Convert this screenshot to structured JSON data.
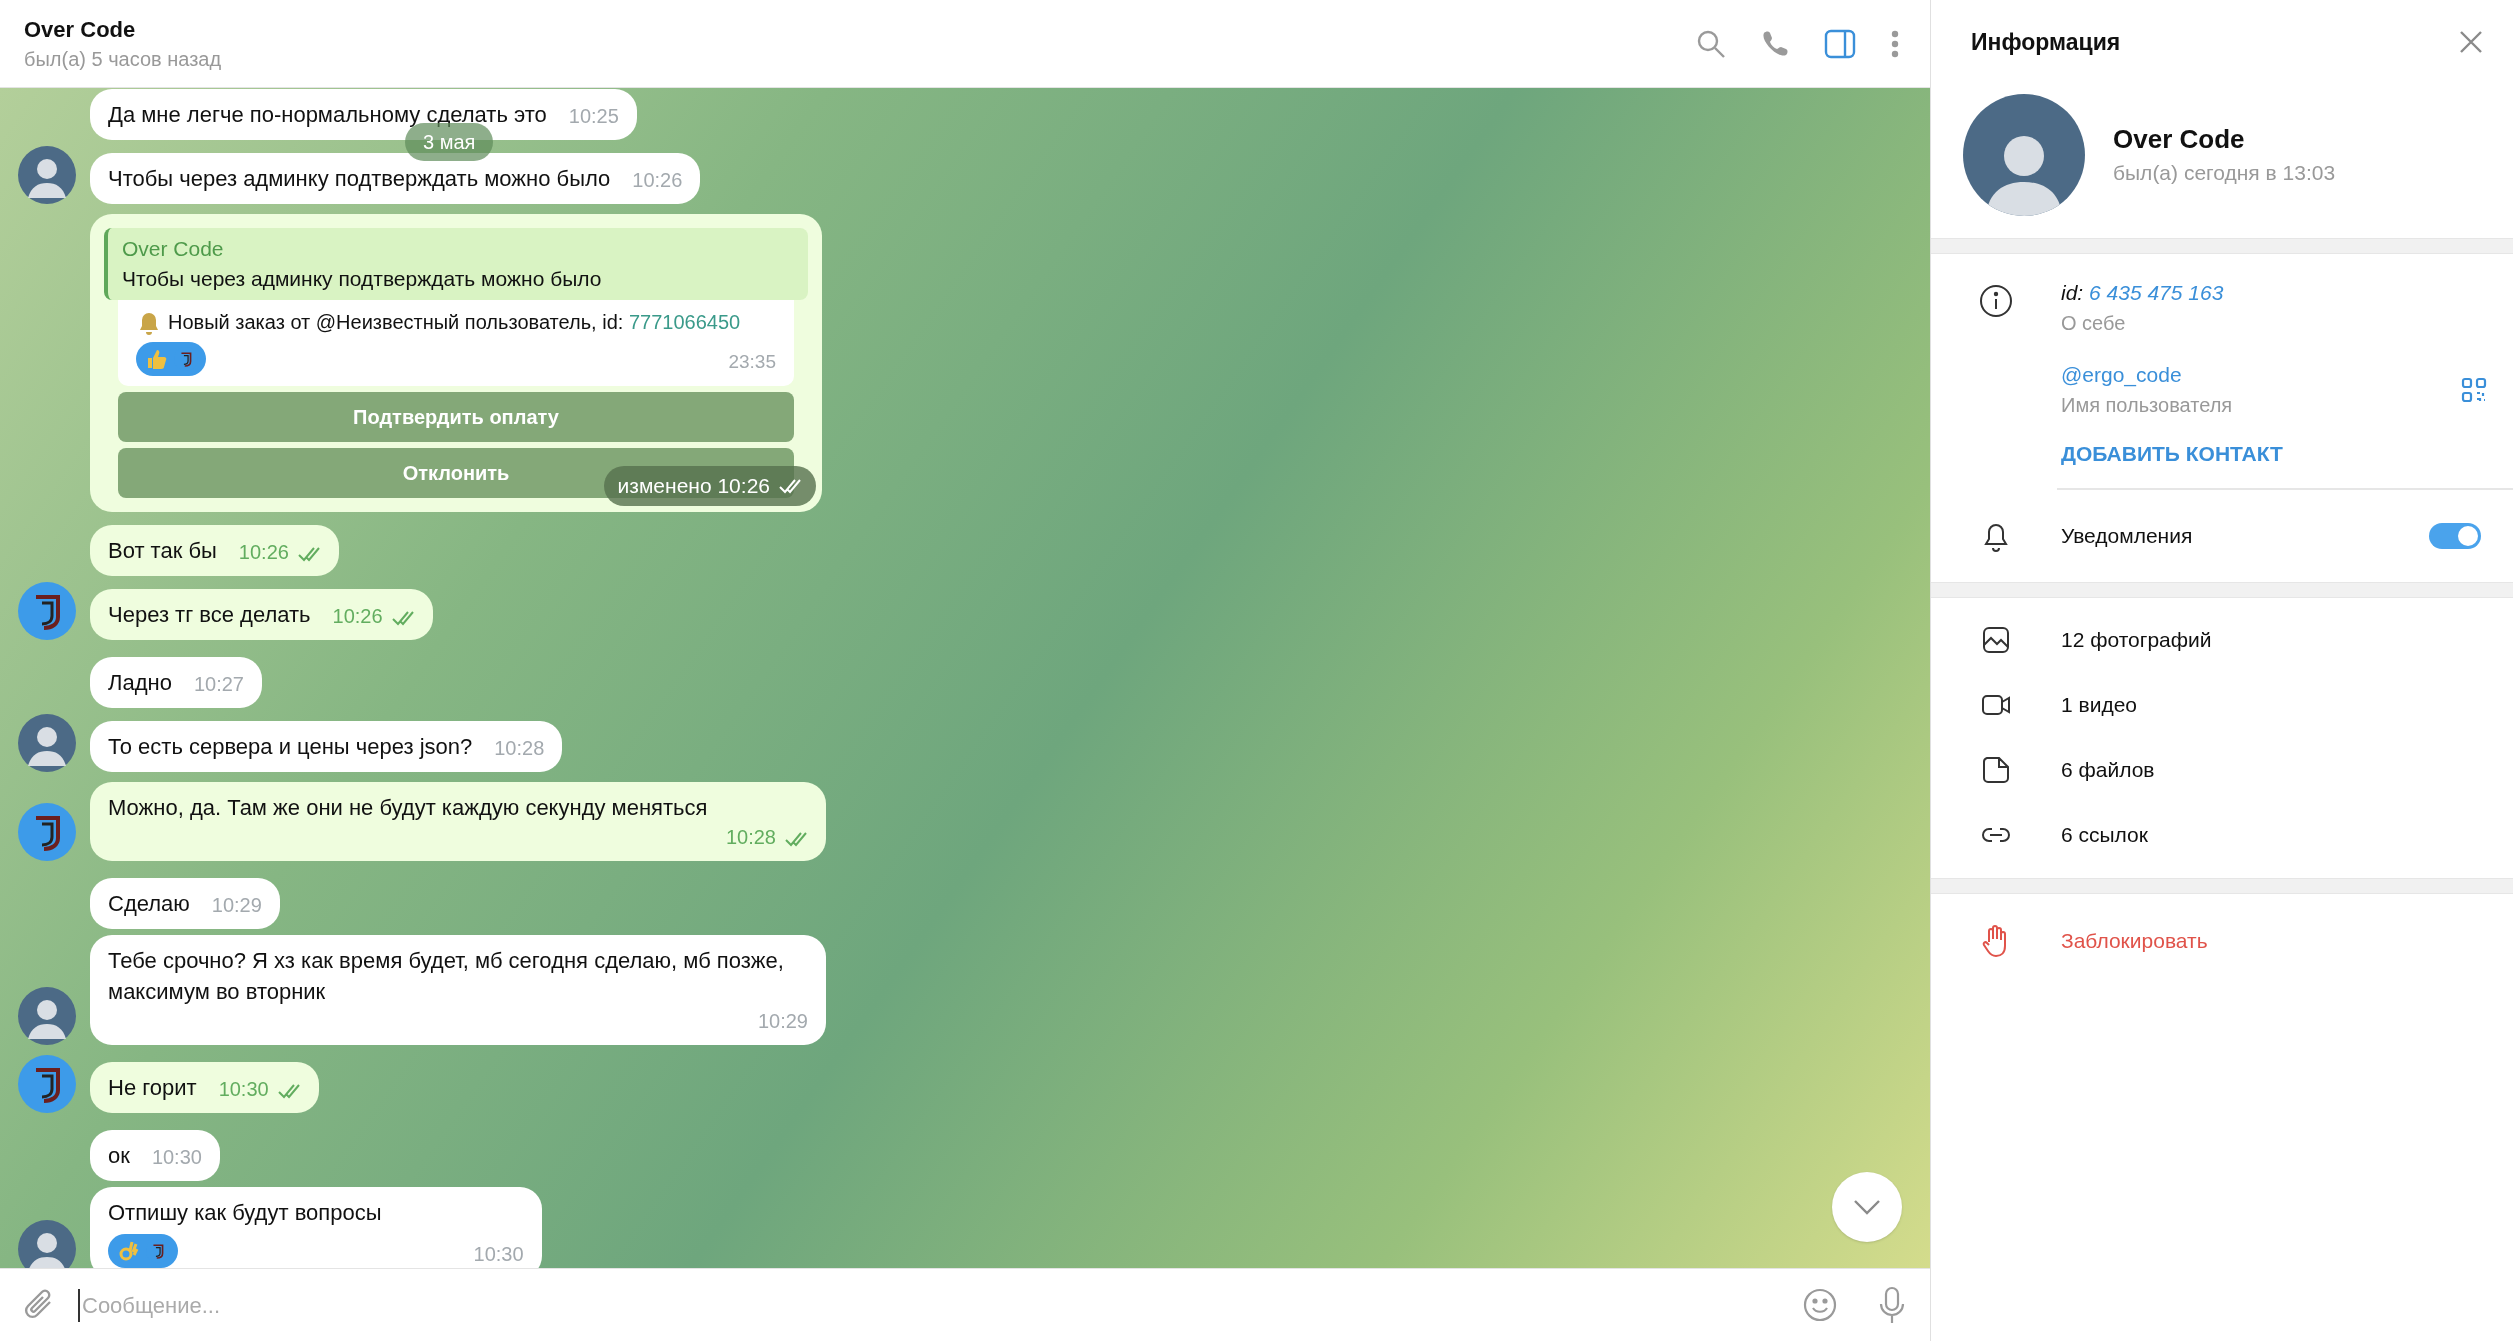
{
  "header": {
    "title": "Over Code",
    "status": "был(а) 5 часов назад",
    "info_panel_open": true
  },
  "messages": [
    {
      "outgoing": false,
      "kind": "text",
      "text": "Да мне легче по-нормальному сделать это",
      "time": "10:25",
      "avatar": false
    },
    {
      "outgoing": false,
      "kind": "text",
      "text": "Чтобы через админку подтверждать можно было",
      "time": "10:26",
      "avatar": true,
      "date_badge": "3 мая"
    },
    {
      "outgoing": true,
      "kind": "reply",
      "reply": {
        "author": "Over Code",
        "text": "Чтобы через админку подтверждать можно было"
      },
      "card": {
        "text": "Новый заказ от @Неизвестный пользователь, id:",
        "link": "7771066450",
        "reaction": {
          "kind": "thumbs"
        },
        "time": "23:35"
      },
      "buttons": [
        "Подтвердить оплату",
        "Отклонить"
      ],
      "time": "изменено 10:26",
      "read": true,
      "avatar": false
    },
    {
      "outgoing": true,
      "kind": "text",
      "text": "Вот так бы",
      "time": "10:26",
      "read": true,
      "avatar": false
    },
    {
      "outgoing": true,
      "kind": "text",
      "text": "Через тг все делать",
      "time": "10:26",
      "read": true,
      "avatar": true
    },
    {
      "outgoing": false,
      "kind": "text",
      "text": "Ладно",
      "time": "10:27",
      "avatar": false
    },
    {
      "outgoing": false,
      "kind": "text",
      "text": "То есть сервера и цены через json?",
      "time": "10:28",
      "avatar": true
    },
    {
      "outgoing": true,
      "kind": "text",
      "text": "Можно, да. Там же они не будут каждую секунду меняться",
      "time": "10:28",
      "read": true,
      "avatar": true
    },
    {
      "outgoing": false,
      "kind": "text",
      "text": "Сделаю",
      "time": "10:29",
      "avatar": false
    },
    {
      "outgoing": false,
      "kind": "text",
      "text": "Тебе срочно? Я хз как время будет, мб сегодня сделаю, мб позже, максимум во вторник",
      "time": "10:29",
      "avatar": true
    },
    {
      "outgoing": true,
      "kind": "text",
      "text": "Не горит",
      "time": "10:30",
      "read": true,
      "avatar": true
    },
    {
      "outgoing": false,
      "kind": "text",
      "text": "ок",
      "time": "10:30",
      "avatar": false
    },
    {
      "outgoing": false,
      "kind": "text",
      "text": "Отпишу как будут вопросы",
      "time": "10:30",
      "reaction": {
        "kind": "ok_hand"
      },
      "avatar": true
    }
  ],
  "composer": {
    "placeholder": "Сообщение..."
  },
  "info_panel": {
    "title": "Информация",
    "profile": {
      "name": "Over Code",
      "status": "был(а) сегодня в 13:03"
    },
    "id_label": "id:",
    "id_value": "6 435 475 163",
    "bio_caption": "О себе",
    "username": "@ergo_code",
    "username_caption": "Имя пользователя",
    "add_contact": "ДОБАВИТЬ КОНТАКТ",
    "notifications": {
      "label": "Уведомления",
      "on": true
    },
    "media": [
      {
        "kind": "photos",
        "label": "12 фотографий"
      },
      {
        "kind": "video",
        "label": "1 видео"
      },
      {
        "kind": "files",
        "label": "6 файлов"
      },
      {
        "kind": "links",
        "label": "6 ссылок"
      }
    ],
    "block": "Заблокировать"
  }
}
